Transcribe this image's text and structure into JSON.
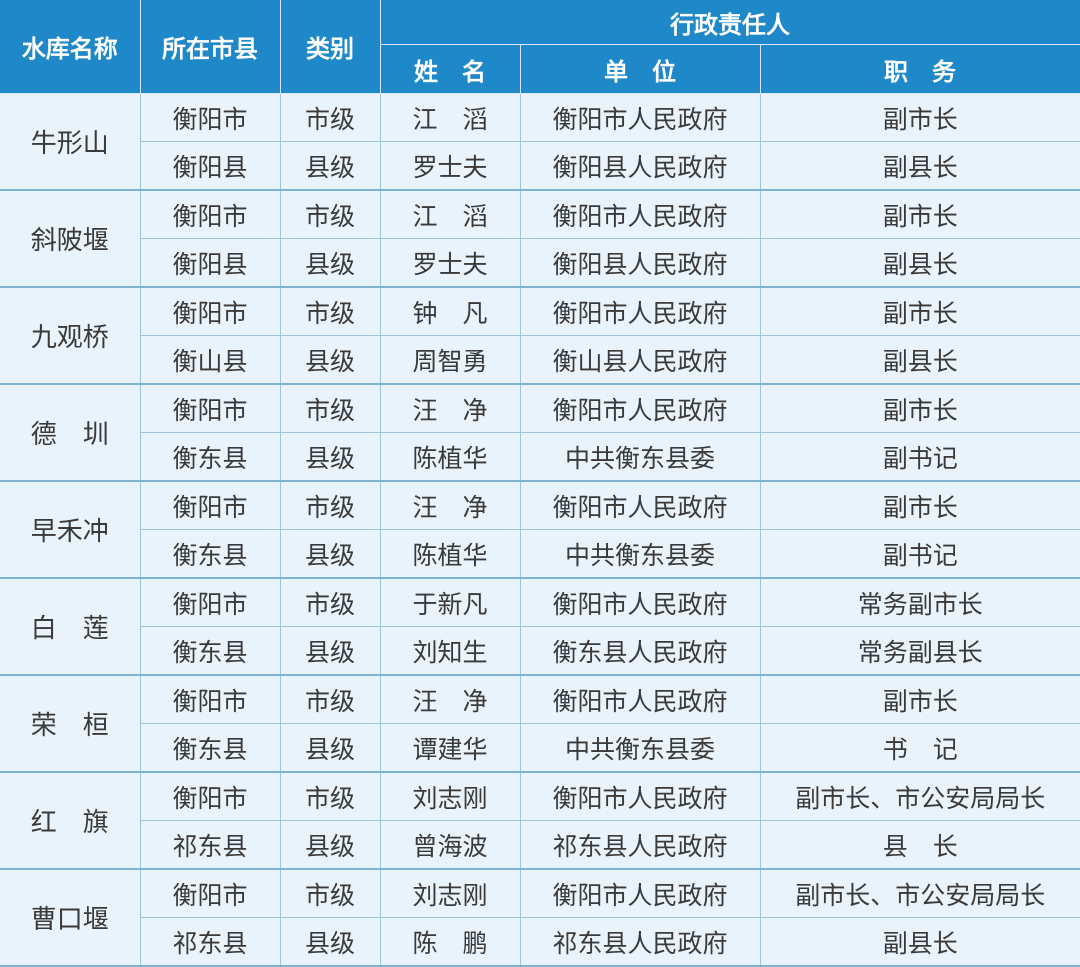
{
  "header": {
    "reservoir_name": "水库名称",
    "county": "所在市县",
    "category": "类别",
    "responsible_group": "行政责任人",
    "name": "姓　名",
    "unit": "单　位",
    "position": "职　务"
  },
  "reservoirs": [
    {
      "name": "牛形山",
      "rows": [
        {
          "county": "衡阳市",
          "category": "市级",
          "person": "江　滔",
          "unit": "衡阳市人民政府",
          "position": "副市长"
        },
        {
          "county": "衡阳县",
          "category": "县级",
          "person": "罗士夫",
          "unit": "衡阳县人民政府",
          "position": "副县长"
        }
      ]
    },
    {
      "name": "斜陂堰",
      "rows": [
        {
          "county": "衡阳市",
          "category": "市级",
          "person": "江　滔",
          "unit": "衡阳市人民政府",
          "position": "副市长"
        },
        {
          "county": "衡阳县",
          "category": "县级",
          "person": "罗士夫",
          "unit": "衡阳县人民政府",
          "position": "副县长"
        }
      ]
    },
    {
      "name": "九观桥",
      "rows": [
        {
          "county": "衡阳市",
          "category": "市级",
          "person": "钟　凡",
          "unit": "衡阳市人民政府",
          "position": "副市长"
        },
        {
          "county": "衡山县",
          "category": "县级",
          "person": "周智勇",
          "unit": "衡山县人民政府",
          "position": "副县长"
        }
      ]
    },
    {
      "name": "德　圳",
      "rows": [
        {
          "county": "衡阳市",
          "category": "市级",
          "person": "汪　净",
          "unit": "衡阳市人民政府",
          "position": "副市长"
        },
        {
          "county": "衡东县",
          "category": "县级",
          "person": "陈植华",
          "unit": "中共衡东县委",
          "position": "副书记"
        }
      ]
    },
    {
      "name": "早禾冲",
      "rows": [
        {
          "county": "衡阳市",
          "category": "市级",
          "person": "汪　净",
          "unit": "衡阳市人民政府",
          "position": "副市长"
        },
        {
          "county": "衡东县",
          "category": "县级",
          "person": "陈植华",
          "unit": "中共衡东县委",
          "position": "副书记"
        }
      ]
    },
    {
      "name": "白　莲",
      "rows": [
        {
          "county": "衡阳市",
          "category": "市级",
          "person": "于新凡",
          "unit": "衡阳市人民政府",
          "position": "常务副市长"
        },
        {
          "county": "衡东县",
          "category": "县级",
          "person": "刘知生",
          "unit": "衡东县人民政府",
          "position": "常务副县长"
        }
      ]
    },
    {
      "name": "荣　桓",
      "rows": [
        {
          "county": "衡阳市",
          "category": "市级",
          "person": "汪　净",
          "unit": "衡阳市人民政府",
          "position": "副市长"
        },
        {
          "county": "衡东县",
          "category": "县级",
          "person": "谭建华",
          "unit": "中共衡东县委",
          "position": "书　记"
        }
      ]
    },
    {
      "name": "红　旗",
      "rows": [
        {
          "county": "衡阳市",
          "category": "市级",
          "person": "刘志刚",
          "unit": "衡阳市人民政府",
          "position": "副市长、市公安局局长"
        },
        {
          "county": "祁东县",
          "category": "县级",
          "person": "曾海波",
          "unit": "祁东县人民政府",
          "position": "县　长"
        }
      ]
    },
    {
      "name": "曹口堰",
      "rows": [
        {
          "county": "衡阳市",
          "category": "市级",
          "person": "刘志刚",
          "unit": "衡阳市人民政府",
          "position": "副市长、市公安局局长"
        },
        {
          "county": "祁东县",
          "category": "县级",
          "person": "陈　鹏",
          "unit": "祁东县人民政府",
          "position": "副县长"
        }
      ]
    }
  ]
}
